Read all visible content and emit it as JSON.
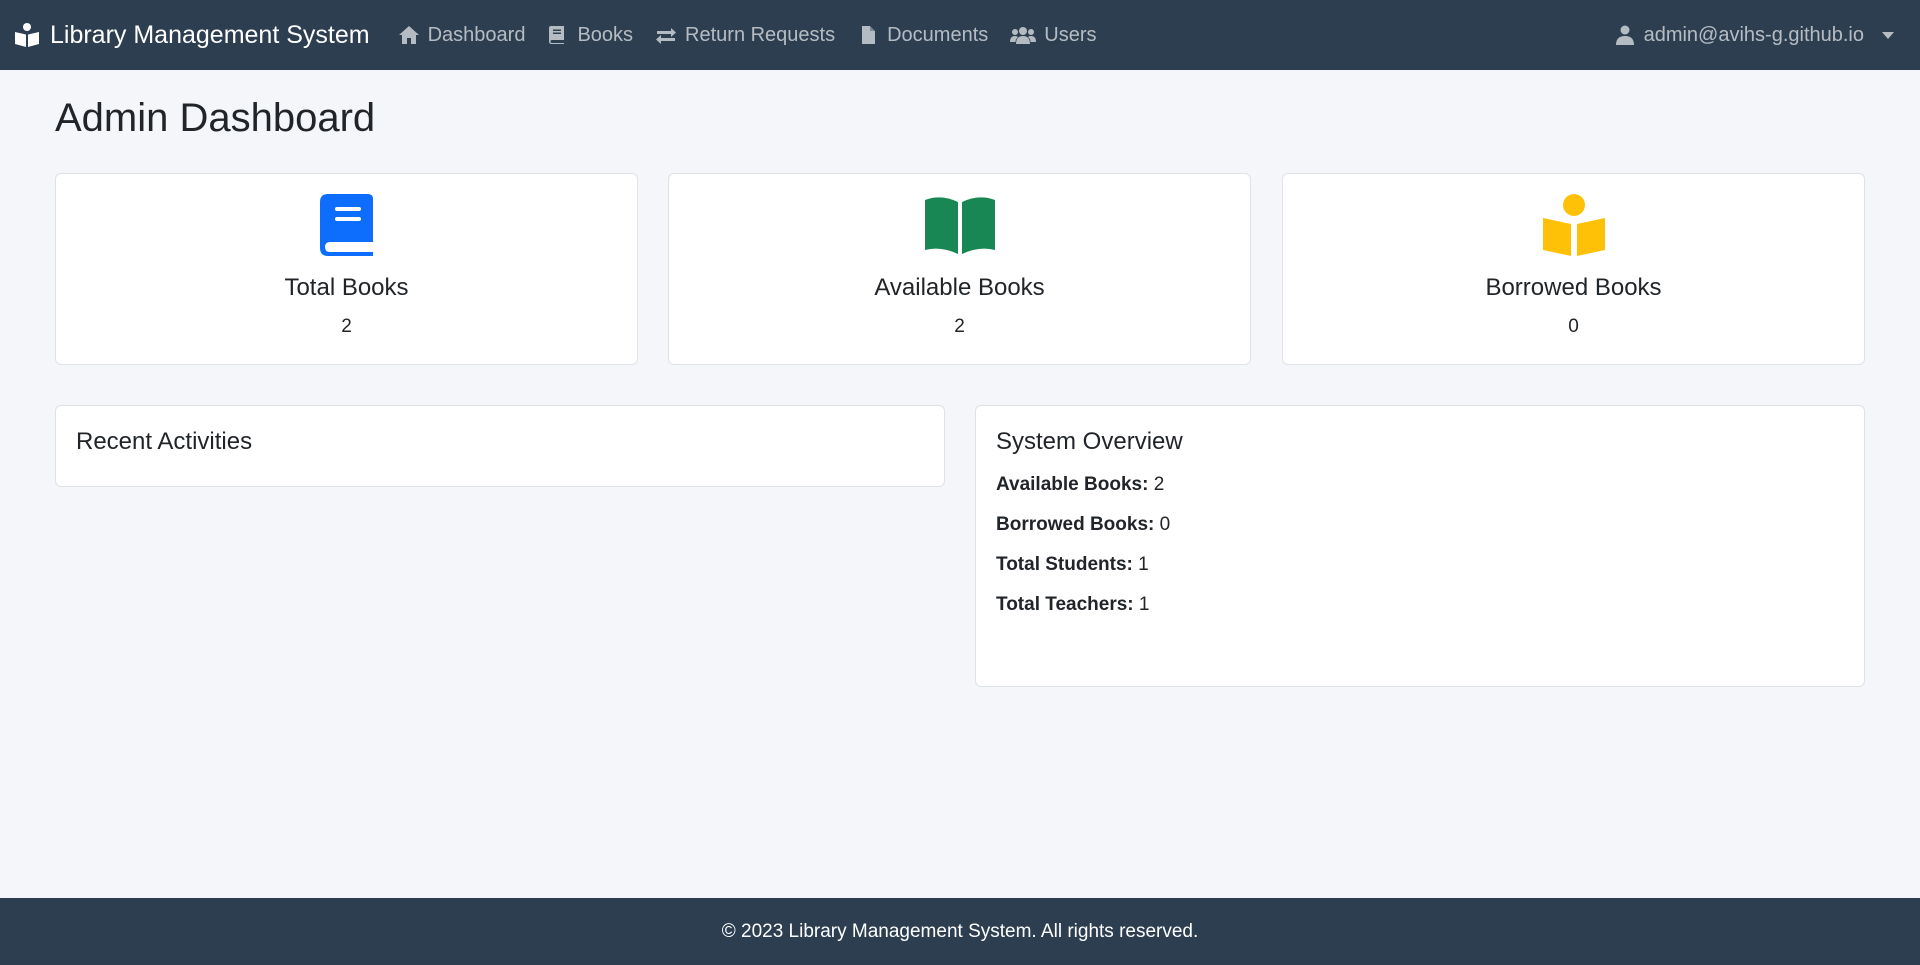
{
  "navbar": {
    "brand": "Library Management System",
    "links": [
      {
        "label": "Dashboard",
        "icon": "home-icon"
      },
      {
        "label": "Books",
        "icon": "book-icon"
      },
      {
        "label": "Return Requests",
        "icon": "exchange-icon"
      },
      {
        "label": "Documents",
        "icon": "file-icon"
      },
      {
        "label": "Users",
        "icon": "users-icon"
      }
    ],
    "user": "admin@avihs-g.github.io"
  },
  "page": {
    "title": "Admin Dashboard"
  },
  "stats": [
    {
      "label": "Total Books",
      "value": "2",
      "color": "#0d6efd"
    },
    {
      "label": "Available Books",
      "value": "2",
      "color": "#198754"
    },
    {
      "label": "Borrowed Books",
      "value": "0",
      "color": "#ffc107"
    }
  ],
  "recent": {
    "title": "Recent Activities"
  },
  "overview": {
    "title": "System Overview",
    "rows": [
      {
        "label": "Available Books:",
        "value": "2"
      },
      {
        "label": "Borrowed Books:",
        "value": "0"
      },
      {
        "label": "Total Students:",
        "value": "1"
      },
      {
        "label": "Total Teachers:",
        "value": "1"
      }
    ]
  },
  "footer": {
    "text": "© 2023 Library Management System. All rights reserved."
  }
}
